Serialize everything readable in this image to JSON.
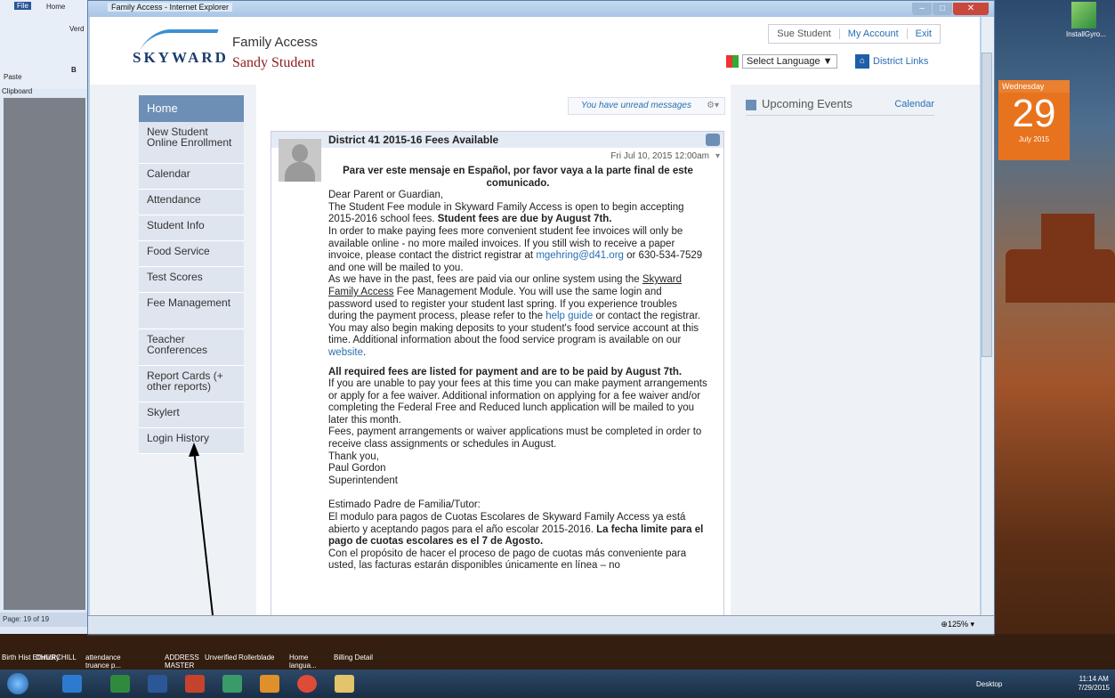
{
  "word": {
    "file_tab": "File",
    "home_tab": "Home",
    "paste": "Paste",
    "clipboard": "Clipboard",
    "font_partial": "Verd",
    "bold": "B",
    "page_status": "Page: 19 of 19"
  },
  "ie": {
    "title": "Family Access - Internet Explorer",
    "zoom": "125%"
  },
  "header": {
    "logo": "SKYWARD",
    "app": "Family Access",
    "student": "Sandy Student",
    "user": "Sue Student",
    "my_account": "My Account",
    "exit": "Exit",
    "select_language": "Select Language",
    "district_links": "District Links"
  },
  "messages": {
    "unread": "You have unread messages"
  },
  "sidebar": {
    "items": [
      {
        "label": "Home"
      },
      {
        "label": "New Student Online Enrollment"
      },
      {
        "label": "Calendar"
      },
      {
        "label": "Attendance"
      },
      {
        "label": "Student Info"
      },
      {
        "label": "Food Service"
      },
      {
        "label": "Test Scores"
      },
      {
        "label": "Fee Management"
      },
      {
        "label": "Teacher Conferences"
      },
      {
        "label": "Report Cards (+ other reports)"
      },
      {
        "label": "Skylert"
      },
      {
        "label": "Login History"
      }
    ]
  },
  "post": {
    "title": "District 41 2015-16 Fees Available",
    "date": "Fri Jul 10, 2015 12:00am",
    "heading": "Para ver este mensaje en Español, por favor vaya a la parte final de este comunicado.",
    "p1": "Dear Parent or Guardian,",
    "p2a": "The Student Fee module in Skyward Family Access is open to begin accepting 2015-2016 school fees. ",
    "p2b": "Student fees are due by August 7th.",
    "p3a": "In order to make paying fees more convenient student fee invoices will only be available online - no more mailed invoices.  If you still wish to receive a paper invoice, please contact the district registrar at ",
    "p3link": "mgehring@d41.org",
    "p3b": " or 630-534-7529 and one will be mailed to you.",
    "p4a": "As we have in the past, fees are paid via our online system using the ",
    "p4link": "Skyward Family Access",
    "p4b": " Fee Management Module.  You will use the same login and password used to register your student last spring. If you experience troubles during the payment process, please refer to the ",
    "p4link2": "help guide",
    "p4c": " or contact the registrar.",
    "p5a": "You may also begin making deposits to your student's food service account at this time.  Additional information about the food service program is available on our ",
    "p5link": "website",
    "p5b": ".",
    "p6": "All required fees are listed for payment and are to be paid by August 7th.",
    "p7": "If you are unable to pay your fees at this time you can make payment arrangements or apply for a fee waiver.  Additional information on applying for a fee waiver and/or completing the Federal Free and Reduced lunch application will be mailed to you later this month.",
    "p8": "Fees, payment arrangements or waiver applications must be completed in order to receive class assignments or schedules in August.",
    "p9": "Thank you,",
    "p10": "Paul Gordon",
    "p11": "Superintendent",
    "p12": "Estimado Padre de Familia/Tutor:",
    "p13a": "El modulo para pagos de Cuotas Escolares de Skyward Family Access ya está abierto y aceptando pagos para el año escolar 2015-2016. ",
    "p13b": "La fecha limite para el pago de cuotas escolares es el 7 de Agosto.",
    "p14": "Con el propósito de hacer el proceso de pago de cuotas más conveniente para usted, las facturas estarán disponibles únicamente en línea – no"
  },
  "upcoming": {
    "title": "Upcoming Events",
    "calendar_link": "Calendar"
  },
  "calendar_widget": {
    "weekday": "Wednesday",
    "day": "29",
    "month": "July 2015"
  },
  "desktop_icon": {
    "label": "InstallGyro..."
  },
  "quick_launch": [
    {
      "label": "Birth Hist Ethnicity"
    },
    {
      "label": "CHURCHILL"
    },
    {
      "label": "attendance truance p..."
    },
    {
      "label": "ADDRESS MASTER"
    },
    {
      "label": "Unverified"
    },
    {
      "label": "Rollerblade"
    },
    {
      "label": "Home langua..."
    },
    {
      "label": "Billing Detail"
    }
  ],
  "taskbar": {
    "desktop": "Desktop",
    "time": "11:14 AM",
    "date": "7/29/2015"
  }
}
